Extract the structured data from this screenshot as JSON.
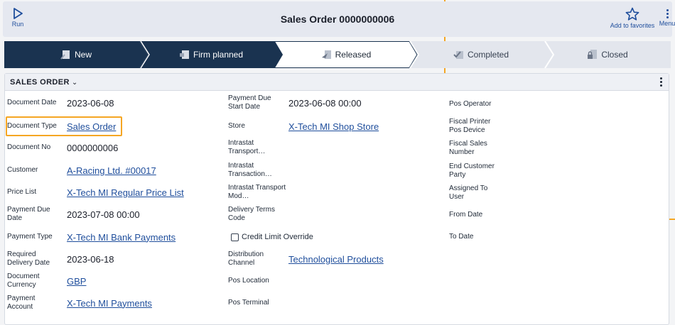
{
  "header": {
    "title": "Sales Order 0000000006",
    "run_label": "Run",
    "favorites_label": "Add to favorites",
    "menu_label": "Menu"
  },
  "steps": [
    {
      "label": "New",
      "state": "done",
      "icon": "new-doc-icon"
    },
    {
      "label": "Firm planned",
      "state": "done",
      "icon": "firm-planned-icon"
    },
    {
      "label": "Released",
      "state": "current",
      "icon": "released-icon"
    },
    {
      "label": "Completed",
      "state": "future",
      "icon": "completed-icon"
    },
    {
      "label": "Closed",
      "state": "future",
      "icon": "closed-lock-icon"
    }
  ],
  "section": {
    "title": "SALES ORDER"
  },
  "col1": [
    {
      "label": "Document Date",
      "value": "2023-06-08",
      "type": "text"
    },
    {
      "label": "Document Type",
      "value": "Sales Order",
      "type": "link"
    },
    {
      "label": "Document No",
      "value": "0000000006",
      "type": "text"
    },
    {
      "label": "Customer",
      "value": "A-Racing Ltd. #00017",
      "type": "link"
    },
    {
      "label": "Price List",
      "value": "X-Tech MI Regular Price List",
      "type": "link"
    },
    {
      "label": "Payment Due Date",
      "value": "2023-07-08 00:00",
      "type": "text"
    },
    {
      "label": "Payment Type",
      "value": "X-Tech MI Bank Payments",
      "type": "link"
    },
    {
      "label": "Required Delivery Date",
      "value": "2023-06-18",
      "type": "text"
    },
    {
      "label": "Document Currency",
      "value": "GBP",
      "type": "link"
    },
    {
      "label": "Payment Account",
      "value": "X-Tech MI Payments",
      "type": "link"
    }
  ],
  "col2": [
    {
      "label": "Payment Due Start Date",
      "value": "2023-06-08 00:00",
      "type": "text"
    },
    {
      "label": "Store",
      "value": "X-Tech MI Shop Store",
      "type": "link"
    },
    {
      "label": "Intrastat Transport…",
      "value": "",
      "type": "text"
    },
    {
      "label": "Intrastat Transaction…",
      "value": "",
      "type": "text"
    },
    {
      "label": "Intrastat Transport Mod…",
      "value": "",
      "type": "text"
    },
    {
      "label": "Delivery Terms Code",
      "value": "",
      "type": "text"
    },
    {
      "label": "",
      "value": "",
      "type": "checkbox",
      "checkbox_label": "Credit Limit Override",
      "checked": false
    },
    {
      "label": "Distribution Channel",
      "value": "Technological Products",
      "type": "link"
    },
    {
      "label": "Pos Location",
      "value": "",
      "type": "text"
    },
    {
      "label": "Pos Terminal",
      "value": "",
      "type": "text"
    }
  ],
  "col3": [
    {
      "label": "Pos Operator",
      "value": ""
    },
    {
      "label": "Fiscal Printer Pos Device",
      "value": ""
    },
    {
      "label": "Fiscal Sales Number",
      "value": ""
    },
    {
      "label": "End Customer Party",
      "value": ""
    },
    {
      "label": "Assigned To User",
      "value": ""
    },
    {
      "label": "From Date",
      "value": ""
    },
    {
      "label": "To Date",
      "value": ""
    }
  ],
  "colors": {
    "step_done": "#1a3350",
    "step_current": "#ffffff",
    "step_future": "#e3e6ed",
    "link": "#1f4e9c",
    "highlight": "#f5a623"
  }
}
